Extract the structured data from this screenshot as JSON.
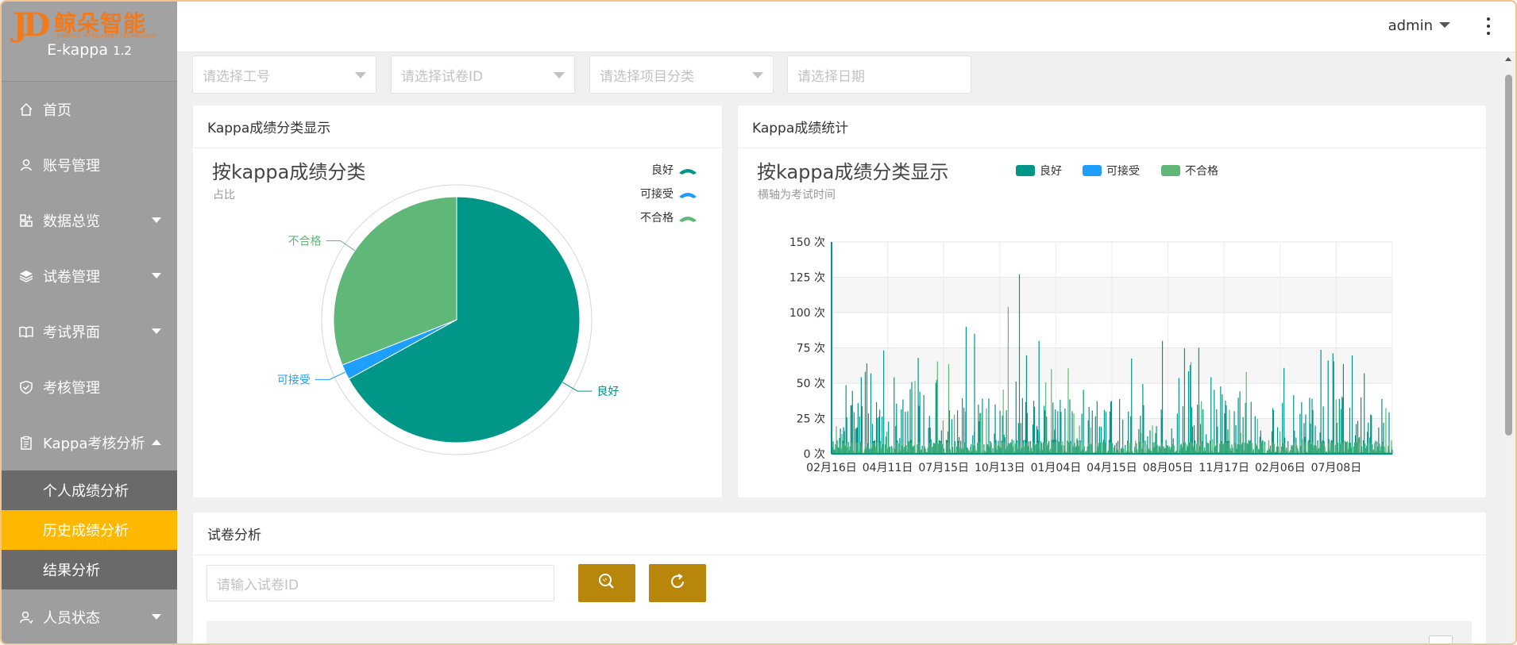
{
  "brand": {
    "logo_mark": "JD",
    "logo_cn": "鲸朵智能",
    "logo_en": "JINGDUO INTELLIGENT TECHNOLOGY",
    "app_name": "E-kappa",
    "version": "1.2"
  },
  "sidebar": {
    "items": [
      {
        "label": "首页",
        "icon": "home-icon"
      },
      {
        "label": "账号管理",
        "icon": "user-icon"
      },
      {
        "label": "数据总览",
        "icon": "grid-icon"
      },
      {
        "label": "试卷管理",
        "icon": "layers-icon"
      },
      {
        "label": "考试界面",
        "icon": "book-icon"
      },
      {
        "label": "考核管理",
        "icon": "shield-check-icon"
      },
      {
        "label": "Kappa考核分析",
        "icon": "clipboard-icon"
      },
      {
        "label": "人员状态",
        "icon": "user-status-icon"
      }
    ],
    "sub_items": [
      {
        "label": "个人成绩分析"
      },
      {
        "label": "历史成绩分析"
      },
      {
        "label": "结果分析"
      }
    ]
  },
  "header": {
    "user": "admin"
  },
  "filters": {
    "employee": "请选择工号",
    "paper_id": "请选择试卷ID",
    "project": "请选择项目分类",
    "date": "请选择日期"
  },
  "pie_card": {
    "card_title": "Kappa成绩分类显示",
    "chart_title": "按kappa成绩分类",
    "chart_subtitle": "占比"
  },
  "line_card": {
    "card_title": "Kappa成绩统计",
    "chart_title": "按kappa成绩分类显示",
    "chart_subtitle": "横轴为考试时间"
  },
  "analysis": {
    "card_title": "试卷分析",
    "input_placeholder": "请输入试卷ID"
  },
  "chart_data": [
    {
      "type": "pie",
      "title": "按kappa成绩分类",
      "subtitle": "占比",
      "legend_position": "top-right",
      "categories": [
        "良好",
        "可接受",
        "不合格"
      ],
      "values": [
        67,
        2,
        31
      ],
      "colors": [
        "#009688",
        "#1e9fff",
        "#5fb878"
      ]
    },
    {
      "type": "area",
      "title": "按kappa成绩分类显示",
      "subtitle": "横轴为考试时间",
      "legend_position": "top",
      "series_names": [
        "良好",
        "可接受",
        "不合格"
      ],
      "colors": [
        "#009688",
        "#1e9fff",
        "#5fb878"
      ],
      "y_unit": "次",
      "ylim": [
        0,
        150
      ],
      "y_ticks": [
        0,
        25,
        50,
        75,
        100,
        125,
        150
      ],
      "x_tick_labels": [
        "02月16日",
        "04月11日",
        "07月15日",
        "10月13日",
        "01月04日",
        "04月15日",
        "08月05日",
        "11月17日",
        "02月06日",
        "07月08日"
      ],
      "grid": true,
      "peaks": [
        {
          "x_index": 0.0,
          "value": 150
        },
        {
          "x_index": 2.4,
          "value": 90
        },
        {
          "x_index": 2.55,
          "value": 85
        },
        {
          "x_index": 3.15,
          "value": 104
        },
        {
          "x_index": 3.35,
          "value": 127
        },
        {
          "x_index": 3.7,
          "value": 80
        },
        {
          "x_index": 5.9,
          "value": 80
        },
        {
          "x_index": 6.55,
          "value": 75
        },
        {
          "x_index": 9.5,
          "value": 57
        }
      ]
    }
  ]
}
